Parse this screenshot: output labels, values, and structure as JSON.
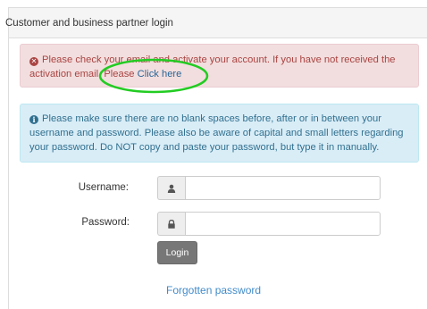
{
  "panel": {
    "heading": "Customer and business partner login"
  },
  "alerts": {
    "danger": {
      "text": "Please check your email and activate your account. If you have not received the activation email, Please ",
      "link_text": "Click here",
      "icon": "times-circle-icon",
      "color": "#a94442"
    },
    "info": {
      "text": "Please make sure there are no blank spaces before, after or in between your username and password. Please also be aware of capital and small letters regarding your password. Do NOT copy and paste your password, but type it in manually.",
      "icon": "info-circle-icon",
      "color": "#31708f"
    }
  },
  "annotation": {
    "ellipse_color": "#22cc22"
  },
  "form": {
    "username_label": "Username:",
    "username_icon": "user-icon",
    "username_value": "",
    "password_label": "Password:",
    "password_icon": "lock-icon",
    "password_value": "",
    "login_label": "Login",
    "forgot_label": "Forgotten password"
  }
}
